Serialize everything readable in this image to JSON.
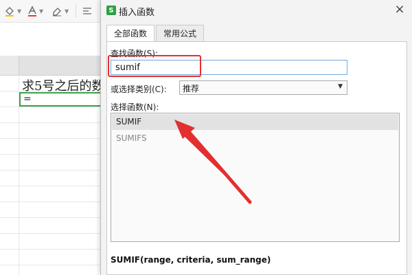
{
  "sheet": {
    "cell_text": "求5号之后的数",
    "active_cell_value": "="
  },
  "dialog": {
    "title": "插入函数",
    "app_icon_letter": "S",
    "close_glyph": "×",
    "tabs": [
      {
        "label": "全部函数",
        "active": true
      },
      {
        "label": "常用公式",
        "active": false
      }
    ],
    "search": {
      "label": "查找函数(S):",
      "value": "sumif"
    },
    "category": {
      "label": "或选择类别(C):",
      "selected": "推荐"
    },
    "functions": {
      "label": "选择函数(N):",
      "items": [
        "SUMIF",
        "SUMIFS"
      ],
      "selected_index": 0
    },
    "signature": "SUMIF(range, criteria, sum_range)"
  },
  "annotation": {
    "highlight_color": "#e32f2f"
  }
}
